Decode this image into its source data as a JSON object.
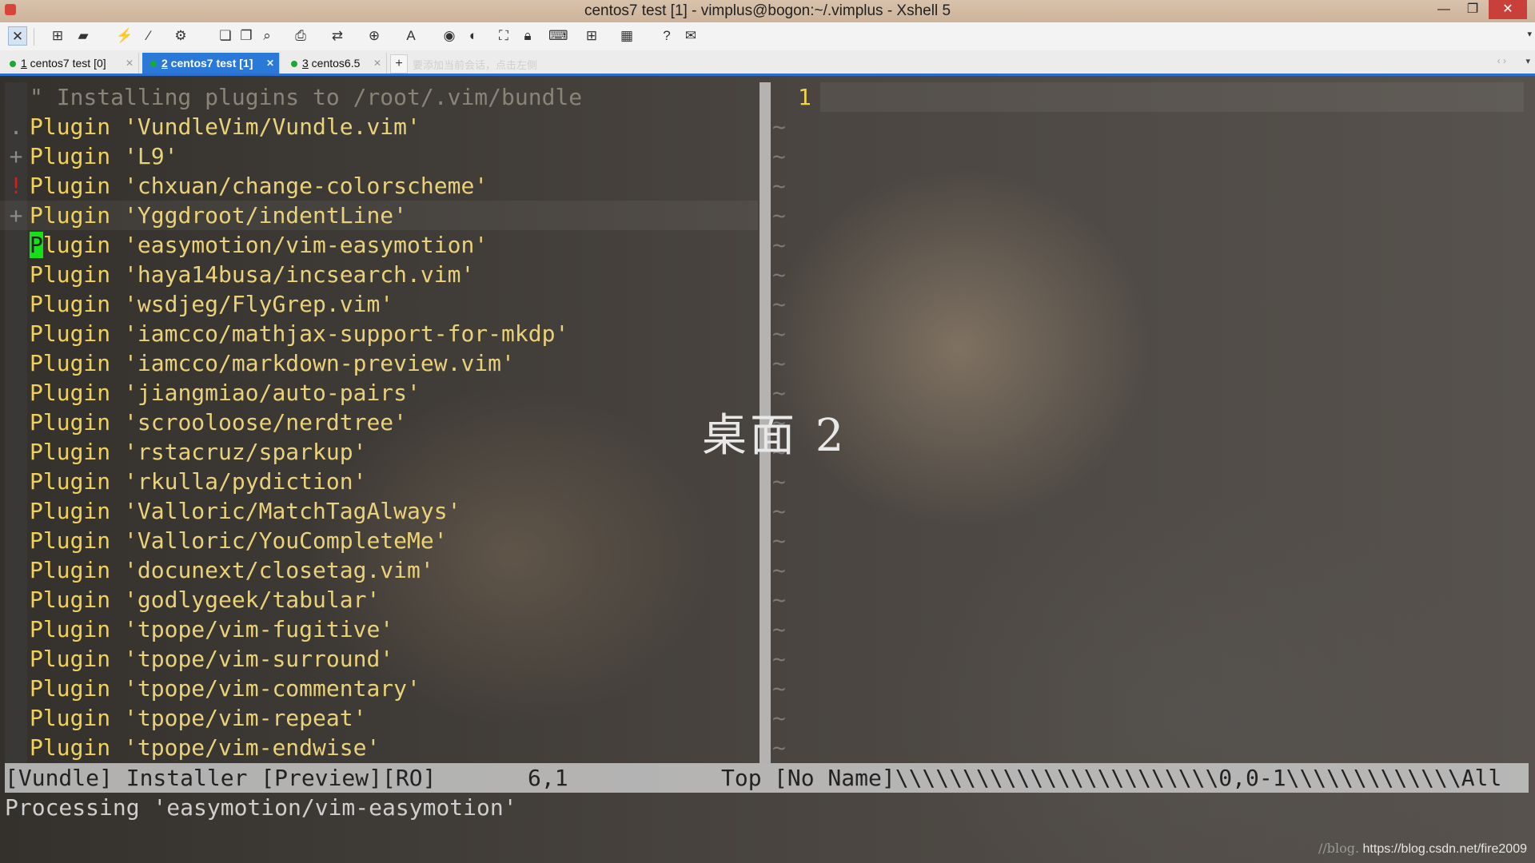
{
  "window": {
    "title": "centos7 test [1] - vimplus@bogon:~/.vimplus - Xshell 5",
    "minimize": "—",
    "maximize": "❐",
    "close": "✕"
  },
  "toolbar": {
    "buttons": [
      "xshell-icon",
      "new-session-icon",
      "open-folder-icon",
      "reconnect-icon",
      "disconnect-icon",
      "properties-icon",
      "copy-icon",
      "paste-icon",
      "find-icon",
      "print-icon",
      "transfer-icon",
      "globe-icon",
      "font-icon",
      "xftp-icon",
      "script-icon",
      "fullscreen-icon",
      "lock-icon",
      "keyboard-icon",
      "add-icon",
      "layout-icon",
      "help-icon",
      "chat-icon"
    ],
    "overflow": "▾"
  },
  "tabs": [
    {
      "num": "1",
      "label": " centos7 test [0]",
      "active": false
    },
    {
      "num": "2",
      "label": " centos7 test [1]",
      "active": true
    },
    {
      "num": "3",
      "label": " centos6.5",
      "active": false
    }
  ],
  "tab_add": "+",
  "tab_ghost": "要添加当前会话，点击左侧",
  "tab_nav": "‹ ›",
  "tab_menu": "▾",
  "left_lines": [
    {
      "sign": "",
      "kind": "comment",
      "text": "\" Installing plugins to /root/.vim/bundle"
    },
    {
      "sign": ".",
      "kind": "plugin",
      "text": "'VundleVim/Vundle.vim'"
    },
    {
      "sign": "+",
      "kind": "plugin",
      "text": "'L9'"
    },
    {
      "sign": "!",
      "kind": "plugin",
      "text": "'chxuan/change-colorscheme'"
    },
    {
      "sign": "+",
      "kind": "plugin",
      "text": "'Yggdroot/indentLine'"
    },
    {
      "sign": "",
      "kind": "plugin",
      "text": "'easymotion/vim-easymotion'"
    },
    {
      "sign": "",
      "kind": "plugin",
      "text": "'haya14busa/incsearch.vim'"
    },
    {
      "sign": "",
      "kind": "plugin",
      "text": "'wsdjeg/FlyGrep.vim'"
    },
    {
      "sign": "",
      "kind": "plugin",
      "text": "'iamcco/mathjax-support-for-mkdp'"
    },
    {
      "sign": "",
      "kind": "plugin",
      "text": "'iamcco/markdown-preview.vim'"
    },
    {
      "sign": "",
      "kind": "plugin",
      "text": "'jiangmiao/auto-pairs'"
    },
    {
      "sign": "",
      "kind": "plugin",
      "text": "'scrooloose/nerdtree'"
    },
    {
      "sign": "",
      "kind": "plugin",
      "text": "'rstacruz/sparkup'"
    },
    {
      "sign": "",
      "kind": "plugin",
      "text": "'rkulla/pydiction'"
    },
    {
      "sign": "",
      "kind": "plugin",
      "text": "'Valloric/MatchTagAlways'"
    },
    {
      "sign": "",
      "kind": "plugin",
      "text": "'Valloric/YouCompleteMe'"
    },
    {
      "sign": "",
      "kind": "plugin",
      "text": "'docunext/closetag.vim'"
    },
    {
      "sign": "",
      "kind": "plugin",
      "text": "'godlygeek/tabular'"
    },
    {
      "sign": "",
      "kind": "plugin",
      "text": "'tpope/vim-fugitive'"
    },
    {
      "sign": "",
      "kind": "plugin",
      "text": "'tpope/vim-surround'"
    },
    {
      "sign": "",
      "kind": "plugin",
      "text": "'tpope/vim-commentary'"
    },
    {
      "sign": "",
      "kind": "plugin",
      "text": "'tpope/vim-repeat'"
    },
    {
      "sign": "",
      "kind": "plugin",
      "text": "'tpope/vim-endwise'"
    }
  ],
  "keyword": "Plugin",
  "cursor_line": 5,
  "right_pane": {
    "line_number": "1",
    "tilde": "~",
    "tilde_count": 22
  },
  "statusline": {
    "left_name": "[Vundle] Installer [Preview][RO]",
    "left_pos": "6,1",
    "left_pct": "Top",
    "right_text": "[No Name]\\\\\\\\\\\\\\\\\\\\\\\\\\\\\\\\\\\\\\\\\\\\\\\\0,0-1\\\\\\\\\\\\\\\\\\\\\\\\\\All"
  },
  "cmdline": "Processing 'easymotion/vim-easymotion'",
  "desktop_label": "桌面 2",
  "watermark": {
    "faint": "//blog.",
    "url": "https://blog.csdn.net/fire2009"
  }
}
